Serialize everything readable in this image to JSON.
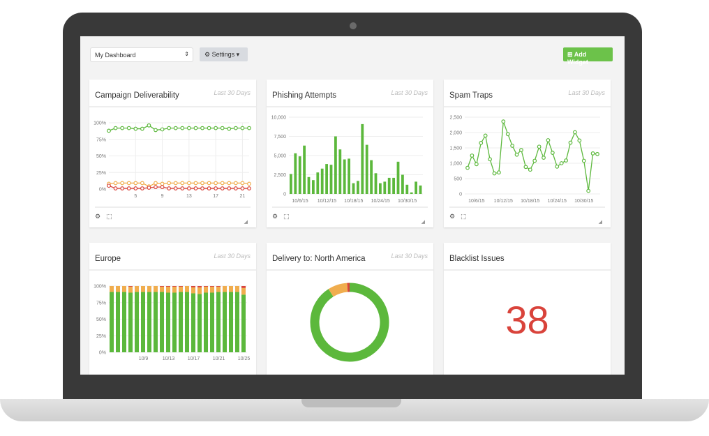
{
  "toolbar": {
    "dashboard_select": "My Dashboard",
    "settings_label": "Settings",
    "add_widget_label": "Add Widget"
  },
  "widgets": [
    {
      "title": "Campaign Deliverability",
      "period": "Last 30 Days"
    },
    {
      "title": "Phishing Attempts",
      "period": "Last 30 Days"
    },
    {
      "title": "Spam Traps",
      "period": "Last 30 Days"
    },
    {
      "title": "Europe",
      "period": "Last 30 Days"
    },
    {
      "title": "Delivery to: North America",
      "period": "Last 30 Days"
    },
    {
      "title": "Blacklist Issues",
      "value": "38"
    }
  ],
  "colors": {
    "green": "#5cb83c",
    "orange": "#f0ad4e",
    "red": "#d9433b",
    "accent": "#6cc24a"
  },
  "icons": [
    "gear-icon",
    "expand-icon",
    "resize-grip-icon",
    "plus-square-icon",
    "caret-down-icon",
    "sort-arrows-icon"
  ],
  "chart_data": [
    {
      "type": "line",
      "x": [
        1,
        2,
        3,
        4,
        5,
        6,
        7,
        8,
        9,
        10,
        11,
        12,
        13,
        14,
        15,
        16,
        17,
        18,
        19,
        20,
        21,
        22
      ],
      "xticks": [
        "5",
        "9",
        "13",
        "17",
        "21"
      ],
      "yticks": [
        "0%",
        "25%",
        "50%",
        "75%",
        "100%"
      ],
      "ylim": [
        0,
        100
      ],
      "series": [
        {
          "color": "#5cb83c",
          "values": [
            88,
            92,
            92,
            92,
            91,
            91,
            96,
            89,
            90,
            92,
            92,
            92,
            92,
            92,
            92,
            92,
            92,
            92,
            91,
            92,
            92,
            92
          ]
        },
        {
          "color": "#f0ad4e",
          "values": [
            8,
            9,
            9,
            9,
            9,
            9,
            4,
            9,
            8,
            9,
            9,
            9,
            9,
            9,
            9,
            9,
            9,
            9,
            9,
            9,
            9,
            8
          ]
        },
        {
          "color": "#d9433b",
          "values": [
            5,
            1,
            1,
            1,
            1,
            1,
            2,
            3,
            3,
            1,
            1,
            1,
            1,
            1,
            1,
            1,
            1,
            1,
            1,
            1,
            1,
            1
          ]
        }
      ]
    },
    {
      "type": "bar",
      "values": [
        2600,
        5300,
        4900,
        6300,
        2200,
        1800,
        2800,
        3300,
        3900,
        3800,
        7500,
        5800,
        4500,
        4600,
        1400,
        1700,
        9100,
        6400,
        4400,
        2700,
        1400,
        1600,
        2100,
        2100,
        4200,
        2500,
        1200,
        200,
        1600,
        1100
      ],
      "xticks": [
        "10/6/15",
        "10/12/15",
        "10/18/15",
        "10/24/15",
        "10/30/15"
      ],
      "yticks": [
        "0",
        "2,500",
        "5,000",
        "7,500",
        "10,000"
      ],
      "ylim": [
        0,
        10000
      ]
    },
    {
      "type": "line",
      "values": [
        850,
        1250,
        970,
        1660,
        1900,
        1130,
        670,
        700,
        2360,
        1950,
        1570,
        1280,
        1430,
        880,
        790,
        1080,
        1540,
        1180,
        1750,
        1340,
        890,
        1000,
        1090,
        1670,
        2010,
        1740,
        1080,
        100,
        1320,
        1300
      ],
      "xticks": [
        "10/6/15",
        "10/12/15",
        "10/18/15",
        "10/24/15",
        "10/30/15"
      ],
      "yticks": [
        "0",
        "500",
        "1,000",
        "1,500",
        "2,000",
        "2,500"
      ],
      "ylim": [
        0,
        2500
      ]
    },
    {
      "type": "bar",
      "stacked": true,
      "categories": [
        "10/4",
        "10/5",
        "10/6",
        "10/7",
        "10/8",
        "10/9",
        "10/10",
        "10/11",
        "10/12",
        "10/13",
        "10/14",
        "10/15",
        "10/16",
        "10/17",
        "10/18",
        "10/19",
        "10/20",
        "10/21",
        "10/22",
        "10/23",
        "10/24",
        "10/25"
      ],
      "xticks": [
        "10/9",
        "10/13",
        "10/17",
        "10/21",
        "10/25"
      ],
      "yticks": [
        "0%",
        "25%",
        "50%",
        "75%",
        "100%"
      ],
      "ylim": [
        0,
        100
      ],
      "series": [
        {
          "color": "#5cb83c",
          "values": [
            91,
            91,
            91,
            90,
            91,
            91,
            91,
            91,
            91,
            90,
            90,
            91,
            91,
            89,
            88,
            90,
            90,
            91,
            91,
            91,
            91,
            87
          ]
        },
        {
          "color": "#f0ad4e",
          "values": [
            9,
            9,
            9,
            9,
            9,
            9,
            9,
            9,
            8,
            9,
            9,
            8,
            9,
            9,
            10,
            9,
            9,
            8,
            9,
            9,
            9,
            10
          ]
        },
        {
          "color": "#d9433b",
          "values": [
            0,
            0,
            0,
            1,
            0,
            0,
            0,
            0,
            1,
            1,
            1,
            1,
            0,
            2,
            2,
            1,
            1,
            1,
            0,
            0,
            0,
            3
          ]
        }
      ]
    },
    {
      "type": "pie",
      "donut": true,
      "values": [
        91,
        8,
        1
      ],
      "colors": [
        "#5cb83c",
        "#f0ad4e",
        "#d9433b"
      ]
    }
  ]
}
